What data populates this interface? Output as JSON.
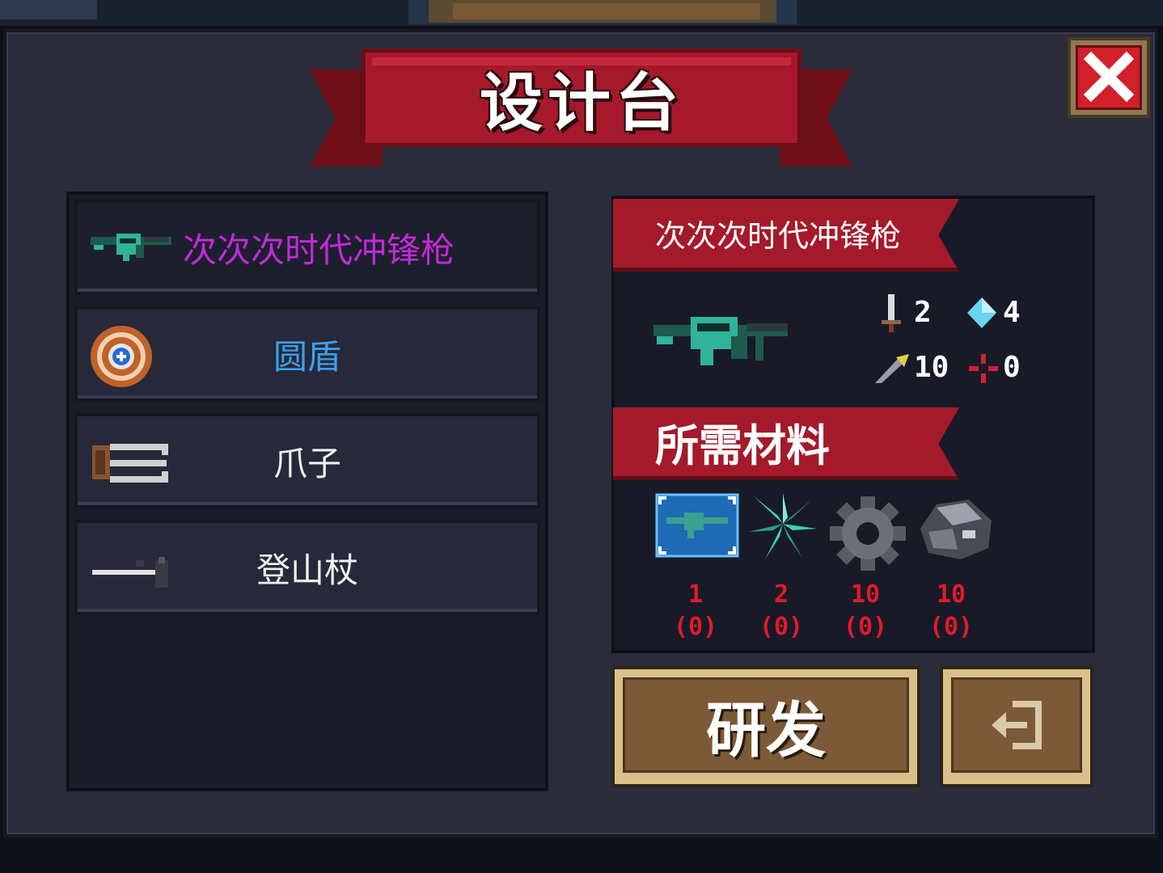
{
  "title": "设计台",
  "list": {
    "items": [
      {
        "label": "次次次时代冲锋枪",
        "icon": "smg-icon",
        "color": "#c129d8",
        "selected": true
      },
      {
        "label": "圆盾",
        "icon": "round-shield-icon",
        "color": "#3aa0f0"
      },
      {
        "label": "爪子",
        "icon": "claw-icon",
        "color": "#f0f0f0"
      },
      {
        "label": "登山杖",
        "icon": "hiking-pole-icon",
        "color": "#f0f0f0"
      }
    ]
  },
  "detail": {
    "name": "次次次时代冲锋枪",
    "icon": "smg-icon",
    "stats": {
      "damage": "2",
      "energy": "4",
      "crit": "10",
      "accuracy": "0"
    },
    "materials_header": "所需材料",
    "materials": [
      {
        "icon": "blueprint-icon",
        "required": "1",
        "owned": "(0)"
      },
      {
        "icon": "crystal-leaf-icon",
        "required": "2",
        "owned": "(0)"
      },
      {
        "icon": "gear-icon",
        "required": "10",
        "owned": "(0)"
      },
      {
        "icon": "ore-icon",
        "required": "10",
        "owned": "(0)"
      }
    ]
  },
  "buttons": {
    "research": "研发",
    "exit_icon": "exit-icon"
  }
}
